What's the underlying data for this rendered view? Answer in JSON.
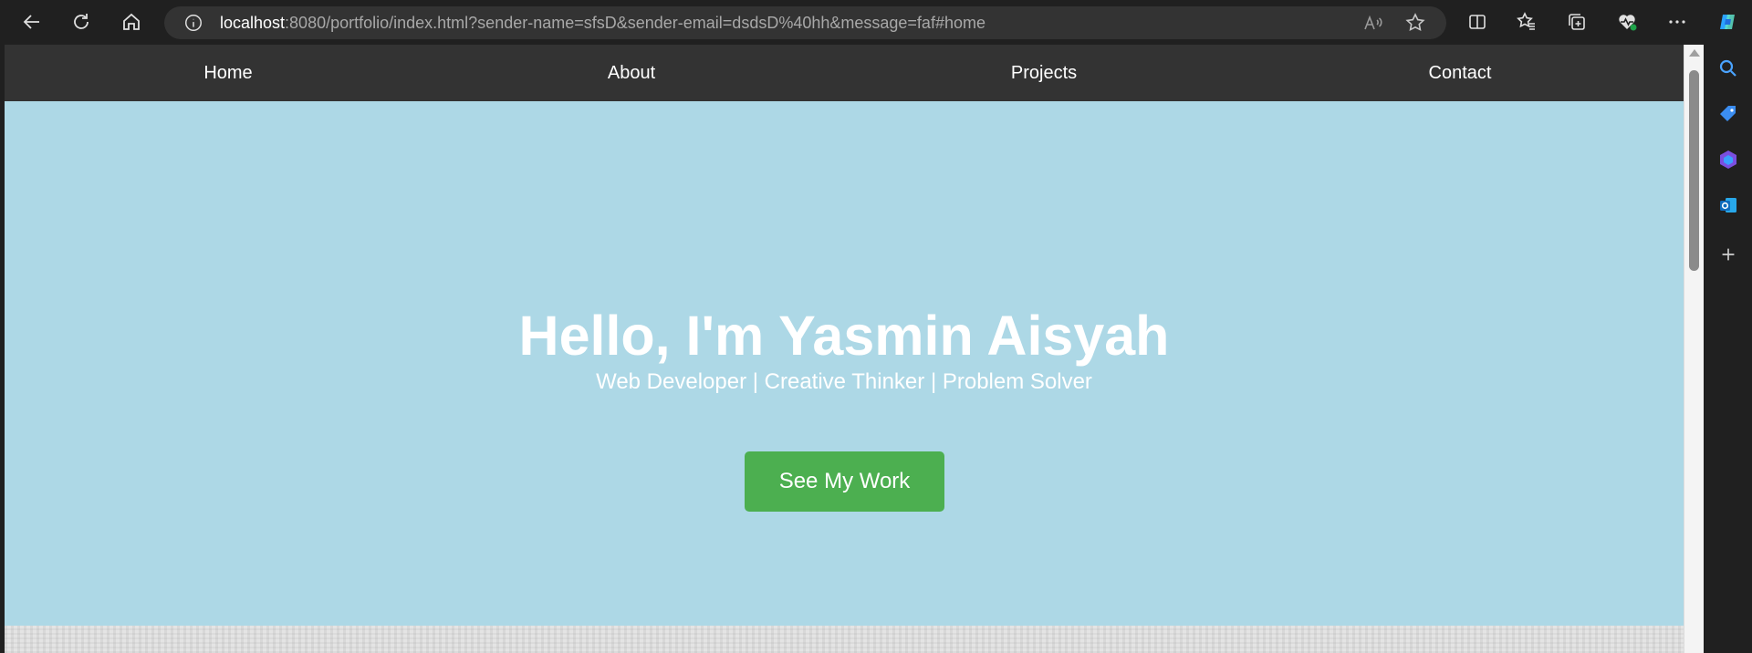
{
  "browser": {
    "url_host": "localhost",
    "url_rest": ":8080/portfolio/index.html?sender-name=sfsD&sender-email=dsdsD%40hh&message=faf#home",
    "icons": [
      "back-icon",
      "refresh-icon",
      "home-icon",
      "info-icon",
      "read-aloud-icon",
      "favorite-star-icon",
      "split-screen-icon",
      "favorites-icon",
      "collections-icon",
      "browser-essentials-icon",
      "more-icon",
      "copilot-icon"
    ],
    "sidebar_icons": [
      "search-icon",
      "shopping-tag-icon",
      "m365-icon",
      "outlook-icon",
      "add-icon"
    ]
  },
  "nav": {
    "items": [
      {
        "label": "Home"
      },
      {
        "label": "About"
      },
      {
        "label": "Projects"
      },
      {
        "label": "Contact"
      }
    ]
  },
  "hero": {
    "title": "Hello, I'm Yasmin Aisyah",
    "subtitle": "Web Developer | Creative Thinker | Problem Solver",
    "cta_label": "See My Work",
    "background_color": "#add8e6",
    "cta_color": "#4caf50"
  },
  "colors": {
    "nav_bg": "#333333",
    "toolbar_bg": "#202020"
  }
}
